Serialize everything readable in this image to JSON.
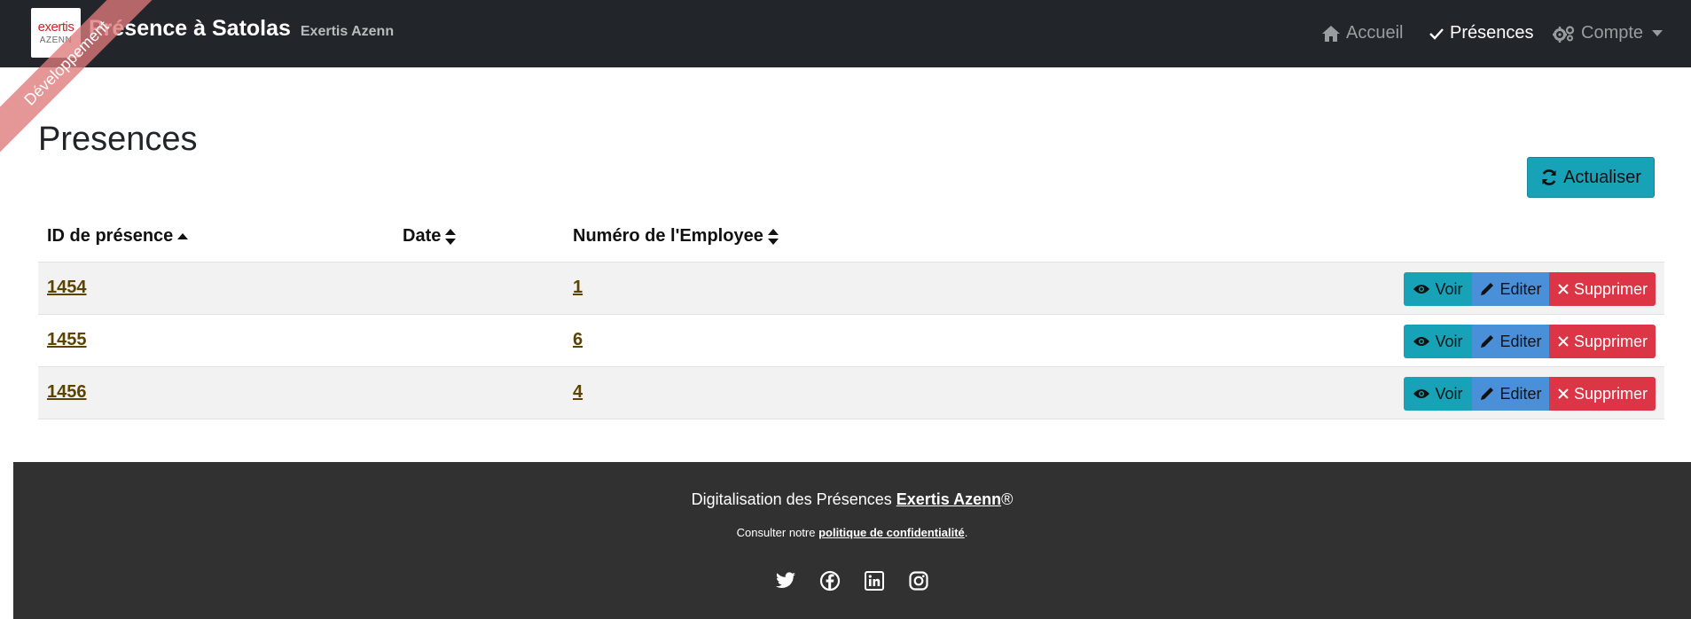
{
  "ribbon": {
    "label": "Développement"
  },
  "navbar": {
    "logo": {
      "line1": "exertis",
      "line2": "AZENN"
    },
    "brand_title": "Présence à Satolas",
    "brand_subtitle": "Exertis Azenn",
    "items": [
      {
        "label": "Accueil",
        "icon": "home-icon"
      },
      {
        "label": "Présences",
        "icon": "check-icon",
        "active": true
      },
      {
        "label": "Compte",
        "icon": "gears-icon",
        "dropdown": true
      }
    ]
  },
  "main": {
    "title": "Presences",
    "refresh_label": "Actualiser",
    "table": {
      "columns": [
        "ID de présence",
        "Date",
        "Numéro de l'Employee"
      ],
      "rows": [
        {
          "id": "1454",
          "date": "",
          "employee": "1"
        },
        {
          "id": "1455",
          "date": "",
          "employee": "6"
        },
        {
          "id": "1456",
          "date": "",
          "employee": "4"
        }
      ],
      "actions": {
        "view": "Voir",
        "edit": "Editer",
        "delete": "Supprimer"
      }
    }
  },
  "footer": {
    "line1_prefix": "Digitalisation des Présences ",
    "line1_link": "Exertis Azenn",
    "line1_suffix": "®",
    "line2_prefix": "Consulter notre ",
    "line2_link": "politique de confidentialité",
    "line2_suffix": ".",
    "socials": [
      "twitter-icon",
      "facebook-icon",
      "linkedin-icon",
      "instagram-icon"
    ]
  },
  "colors": {
    "navbar_bg": "#22262a",
    "info": "#17a2b8",
    "primary": "#4a90d9",
    "danger": "#dc3545",
    "footer_bg": "#313131",
    "link": "#5c4400"
  }
}
